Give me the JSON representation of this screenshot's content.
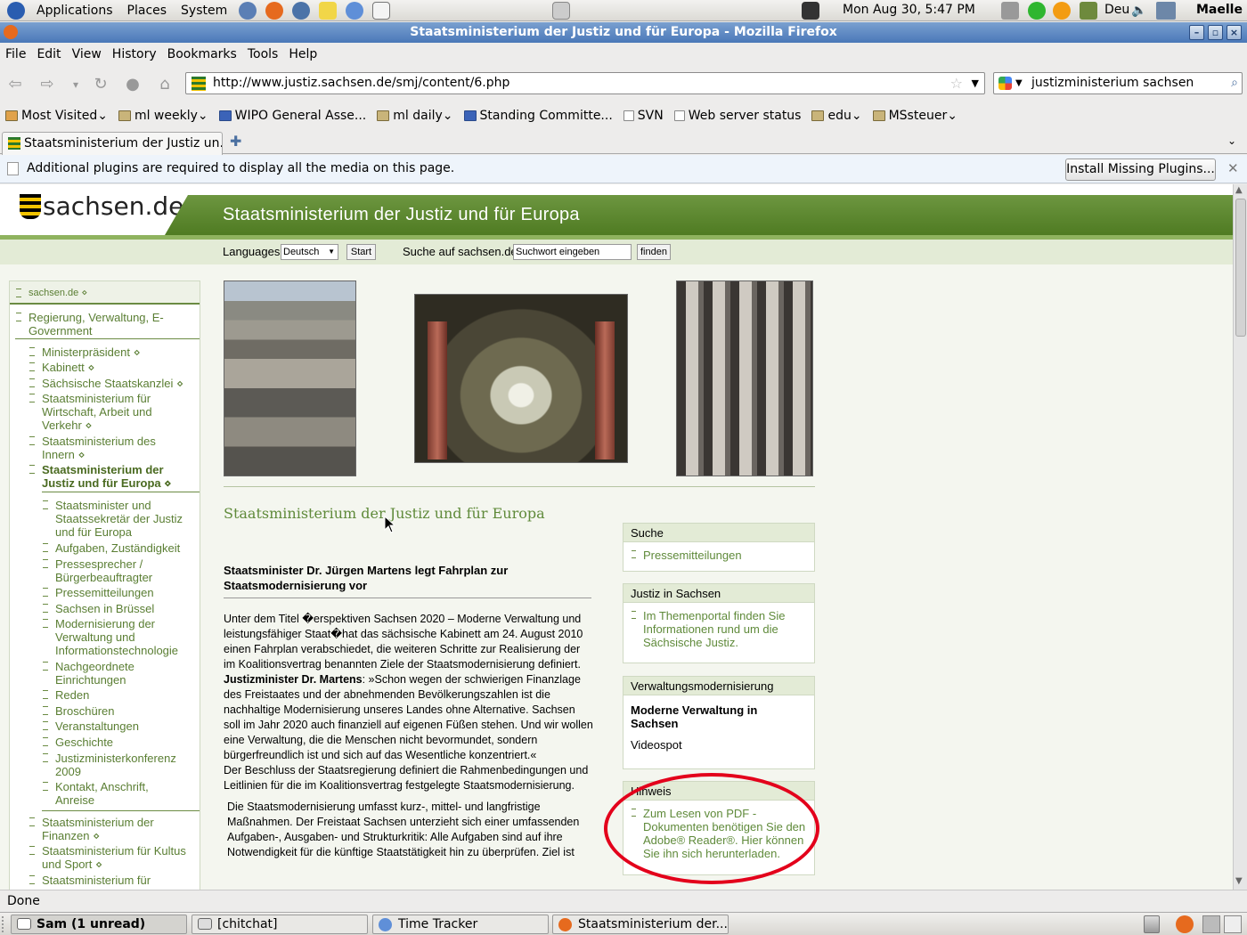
{
  "panel": {
    "menus": [
      "Applications",
      "Places",
      "System"
    ],
    "clock": "Mon Aug 30,  5:47 PM",
    "keyboard": "Deu",
    "user": "Maelle"
  },
  "window": {
    "title": "Staatsministerium der Justiz und für Europa - Mozilla Firefox"
  },
  "menubar": [
    "File",
    "Edit",
    "View",
    "History",
    "Bookmarks",
    "Tools",
    "Help"
  ],
  "nav": {
    "url": "http://www.justiz.sachsen.de/smj/content/6.php",
    "search": "justizministerium sachsen"
  },
  "bookmarks": [
    "Most Visited",
    "ml weekly",
    "WIPO General Asse...",
    "ml daily",
    "Standing Committe...",
    "SVN",
    "Web server status",
    "edu",
    "MSsteuer"
  ],
  "tab": {
    "label": "Staatsministerium der Justiz un..."
  },
  "plugin": {
    "message": "Additional plugins are required to display all the media on this page.",
    "button": "Install Missing Plugins..."
  },
  "site": {
    "logo": "sachsen.de",
    "header": "Staatsministerium der Justiz und für Europa",
    "languages_label": "Languages",
    "language_value": "Deutsch",
    "start": "Start",
    "search_label": "Suche auf sachsen.de",
    "search_placeholder": "Suchwort eingeben",
    "find": "finden",
    "breadcrumb": "sachsen.de",
    "nav": [
      "Regierung, Verwaltung, E-Government",
      "Ministerpräsident",
      "Kabinett",
      "Sächsische Staatskanzlei",
      "Staatsministerium für Wirtschaft, Arbeit und Verkehr",
      "Staatsministerium des Innern",
      "Staatsministerium der Justiz und für Europa",
      "Staatsminister und Staatssekretär der Justiz und für Europa",
      "Aufgaben, Zuständigkeit",
      "Pressesprecher / Bürgerbeauftragter",
      "Pressemitteilungen",
      "Sachsen in Brüssel",
      "Modernisierung der Verwaltung und Informationstechnologie",
      "Nachgeordnete Einrichtungen",
      "Reden",
      "Broschüren",
      "Veranstaltungen",
      "Geschichte",
      "Justizministerkonferenz 2009",
      "Kontakt, Anschrift, Anreise",
      "Staatsministerium der Finanzen",
      "Staatsministerium für Kultus und Sport",
      "Staatsministerium für"
    ],
    "page_title": "Staatsministerium der Justiz und für Europa",
    "headline": "Staatsminister Dr. Jürgen Martens legt Fahrplan zur Staatsmodernisierung vor",
    "para1a": "Unter dem Titel �erspektiven Sachsen 2020 – Moderne Verwaltung und leistungsfähiger Staat�hat das sächsische Kabinett am 24. August 2010 einen Fahrplan verabschiedet, die weiteren Schritte zur Realisierung der im Koalitionsvertrag benannten Ziele der Staatsmodernisierung definiert. ",
    "para1b": "Justizminister Dr. Martens",
    "para1c": ": »Schon wegen der schwierigen Finanzlage des Freistaates und der abnehmenden Bevölkerungszahlen ist die nachhaltige Modernisierung unseres Landes ohne Alternative. Sachsen soll im Jahr 2020 auch finanziell auf eigenen Füßen stehen. Und wir wollen eine Verwaltung, die die Menschen nicht bevormundet, sondern bürgerfreundlich ist und sich auf das Wesentliche konzentriert.«",
    "para2": "Der Beschluss der Staatsregierung definiert die Rahmenbedingungen und Leitlinien für die im Koalitionsvertrag festgelegte Staatsmodernisierung.",
    "para3": "Die Staatsmodernisierung umfasst kurz-, mittel- und langfristige Maßnahmen. Der Freistaat Sachsen unterzieht sich einer umfassenden Aufgaben-, Ausgaben- und Strukturkritik: Alle Aufgaben sind auf ihre Notwendigkeit für die künftige Staatstätigkeit hin zu überprüfen. Ziel ist",
    "boxes": {
      "suche": {
        "title": "Suche",
        "link": "Pressemitteilungen"
      },
      "justiz": {
        "title": "Justiz in Sachsen",
        "link": "Im Themenportal finden Sie Informationen rund um die Sächsische Justiz."
      },
      "verw": {
        "title": "Verwaltungsmodernisierung",
        "bold": "Moderne Verwaltung in Sachsen",
        "text": "Videospot"
      },
      "hinweis": {
        "title": "Hinweis",
        "link": "Zum Lesen von PDF - Dokumenten benötigen Sie den Adobe® Reader®. Hier können Sie ihn sich herunterladen."
      }
    }
  },
  "status": "Done",
  "taskbar": [
    "Sam (1 unread)",
    "[chitchat]",
    "Time Tracker",
    "Staatsministerium der..."
  ],
  "colors": {
    "accent_green": "#5f8a3a",
    "annotation_red": "#e3001b"
  }
}
